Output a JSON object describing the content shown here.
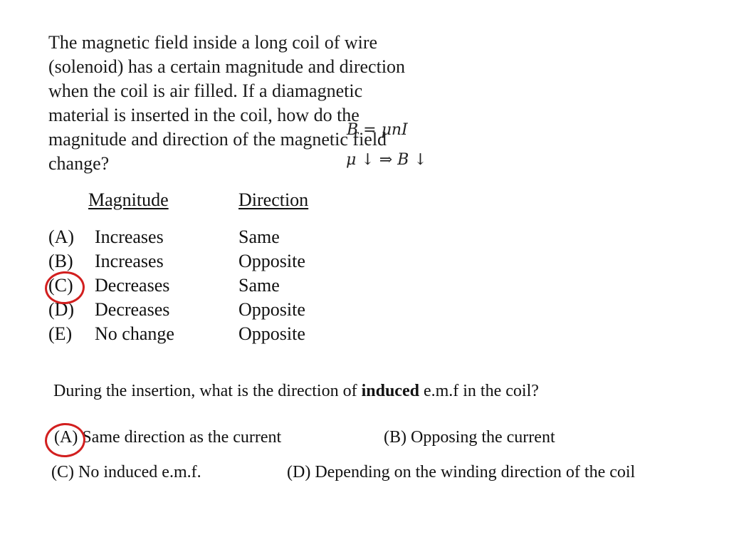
{
  "question1": {
    "lines": [
      "The magnetic field inside a long coil of wire",
      "(solenoid) has a certain magnitude and direction",
      "when the coil is air filled. If a diamagnetic",
      "material is inserted in the coil, how do the",
      "magnitude and direction of the magnetic field",
      "change?"
    ],
    "annotation": {
      "formula": "B = μnI",
      "implication": "μ ↓  ⇒  B ↓"
    },
    "headers": {
      "magnitude": "Magnitude",
      "direction": "Direction"
    },
    "options": [
      {
        "letter": "(A)",
        "magnitude": "Increases",
        "direction": "Same"
      },
      {
        "letter": "(B)",
        "magnitude": "Increases",
        "direction": "Opposite"
      },
      {
        "letter": "(C)",
        "magnitude": "Decreases",
        "direction": "Same"
      },
      {
        "letter": "(D)",
        "magnitude": "Decreases",
        "direction": "Opposite"
      },
      {
        "letter": "(E)",
        "magnitude": "No change",
        "direction": "Opposite"
      }
    ],
    "marked_answer": "(C)"
  },
  "question2": {
    "prefix": "During the insertion, what is the direction of ",
    "bold": "induced",
    "suffix": " e.m.f in the coil?",
    "options": {
      "A": "(A) Same direction as the current",
      "B": "(B) Opposing the current",
      "C": "(C) No induced e.m.f.",
      "D": "(D) Depending on the winding direction of the coil"
    },
    "marked_answer": "(A)"
  },
  "colors": {
    "mark": "#d21f1f",
    "text": "#111111"
  }
}
